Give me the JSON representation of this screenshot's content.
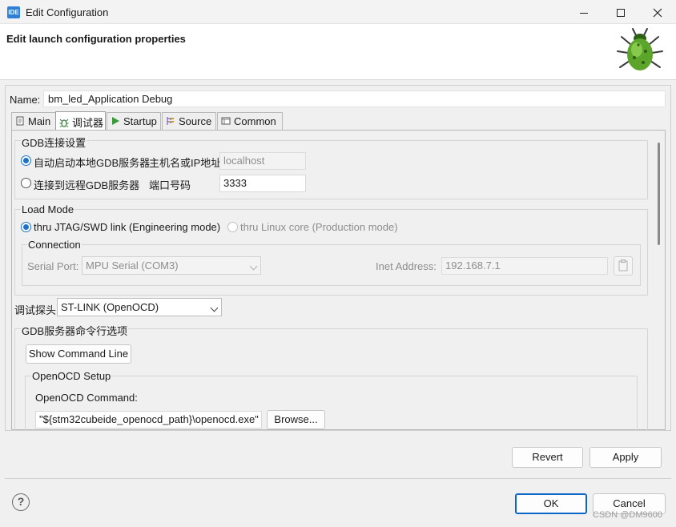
{
  "window": {
    "app_icon_text": "IDE",
    "title": "Edit Configuration"
  },
  "header": {
    "title": "Edit launch configuration properties"
  },
  "name_field": {
    "label": "Name:",
    "value": "bm_led_Application Debug"
  },
  "tabs": [
    {
      "label": "Main",
      "icon": "main-icon"
    },
    {
      "label": "调试器",
      "icon": "debugger-icon",
      "active": true
    },
    {
      "label": "Startup",
      "icon": "startup-icon"
    },
    {
      "label": "Source",
      "icon": "source-icon"
    },
    {
      "label": "Common",
      "icon": "common-icon"
    }
  ],
  "gdb_connection": {
    "title": "GDB连接设置",
    "local_radio": "自动启动本地GDB服务器",
    "remote_radio": "连接到远程GDB服务器",
    "host_label": "主机名或IP地址",
    "host_value": "localhost",
    "port_label": "端口号码",
    "port_value": "3333"
  },
  "load_mode": {
    "title": "Load Mode",
    "jtag_radio": "thru JTAG/SWD link (Engineering mode)",
    "linux_radio": "thru Linux core (Production mode)",
    "connection_title": "Connection",
    "serial_port_label": "Serial Port:",
    "serial_port_value": "MPU Serial (COM3)",
    "inet_label": "Inet Address:",
    "inet_value": "192.168.7.1"
  },
  "probe": {
    "label": "调试探头",
    "value": "ST-LINK (OpenOCD)"
  },
  "gdb_server_options": {
    "title": "GDB服务器命令行选项",
    "show_cmd_button": "Show Command Line",
    "openocd_setup_title": "OpenOCD Setup",
    "openocd_cmd_label": "OpenOCD Command:",
    "openocd_cmd_value": "\"${stm32cubeide_openocd_path}\\openocd.exe\"",
    "browse_button": "Browse..."
  },
  "actions": {
    "revert": "Revert",
    "apply": "Apply",
    "ok": "OK",
    "cancel": "Cancel"
  },
  "help_icon_text": "?",
  "watermark": "CSDN @DM9600",
  "colors": {
    "accent": "#1a73c9",
    "primary_border": "#0a66c7"
  }
}
